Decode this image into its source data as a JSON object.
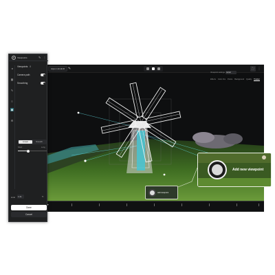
{
  "viewer": {
    "project_chip": "Aspen windmill",
    "tabs": [
      "Effects",
      "Color ribs",
      "Points",
      "Background",
      "Quality",
      "Tracker"
    ],
    "active_tab_index": 5,
    "workspace_label": "Viewpoint settings",
    "workspace_value": "Aerial",
    "thumbnail_label": "Add viewpoint"
  },
  "callout": {
    "label": "Add new viewpoint"
  },
  "panel": {
    "title": "Viewpoints",
    "rows": [
      {
        "label": "Viewpoints",
        "count": "8",
        "toggle": false
      },
      {
        "label": "Camera path",
        "count": "",
        "toggle": true
      },
      {
        "label": "Smoothing",
        "count": "",
        "toggle": true
      }
    ],
    "segments": [
      "Linear",
      "Smooth"
    ],
    "selected_segment": 0,
    "slider_min_label": "Short",
    "slider_max_label": "Long",
    "slider_value": 0.35,
    "limit_label": "Limit",
    "limit_value": "1.2s",
    "done_label": "Done",
    "cancel_label": "Cancel"
  },
  "colors": {
    "accent": "#2f6f7a",
    "cloud_cyan": "#55d4e0",
    "grass": "#4a7a2a"
  }
}
